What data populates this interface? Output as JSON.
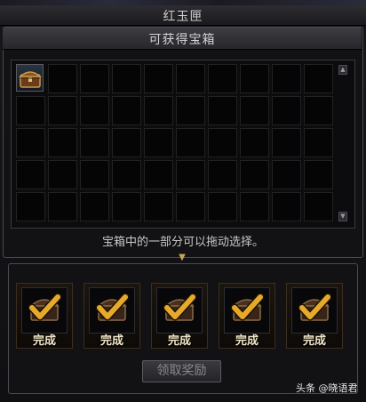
{
  "window": {
    "title": "红玉匣"
  },
  "chest_panel": {
    "header": "可获得宝箱",
    "hint": "宝箱中的一部分可以拖动选择。",
    "grid": {
      "columns": 10,
      "rows": 5,
      "filled_slots": [
        0
      ]
    }
  },
  "rewards": {
    "items": [
      {
        "label": "完成"
      },
      {
        "label": "完成"
      },
      {
        "label": "完成"
      },
      {
        "label": "完成"
      },
      {
        "label": "完成"
      }
    ],
    "claim_button": "领取奖励"
  },
  "watermark": "头条 @晓语君",
  "colors": {
    "check_gold": "#e6a92a",
    "title_accent": "#2aa3a8"
  }
}
